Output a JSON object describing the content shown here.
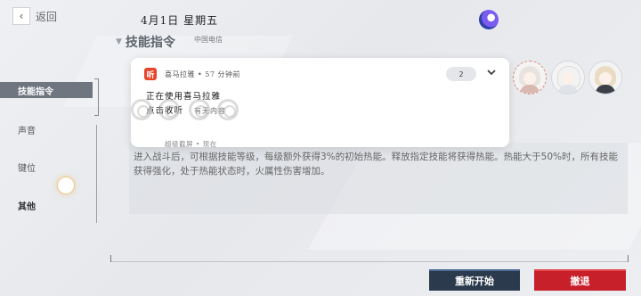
{
  "header": {
    "back_label": "返回",
    "back_icon": "chevron-left-icon",
    "date": "4月1日 星期五",
    "carrier": "中国电信"
  },
  "section": {
    "title": "技能指令"
  },
  "sidebar": {
    "items": [
      {
        "label": "技能指令",
        "active": true
      },
      {
        "label": "声音",
        "active": false
      },
      {
        "label": "键位",
        "active": false
      },
      {
        "label": "其他",
        "active": false
      }
    ]
  },
  "notification": {
    "app_icon_label": "听",
    "app_name_line": "喜马拉雅 • 57 分钟前",
    "count": "2",
    "line1": "正在使用喜马拉雅",
    "line2": "点击收听",
    "line2_sub": "有无内容",
    "footer": "超级截屏 • 现在"
  },
  "description": {
    "text": "进入战斗后，可根据技能等级，每级额外获得3%的初始热能。释放指定技能将获得热能。热能大于50%时，所有技能获得强化，处于热能状态时，火属性伤害增加。"
  },
  "buttons": {
    "restart": "重新开始",
    "retreat": "撤退"
  },
  "colors": {
    "restart_bg": "#2c3a4e",
    "retreat_bg": "#c8202a",
    "active_tab_bg": "#707680"
  }
}
